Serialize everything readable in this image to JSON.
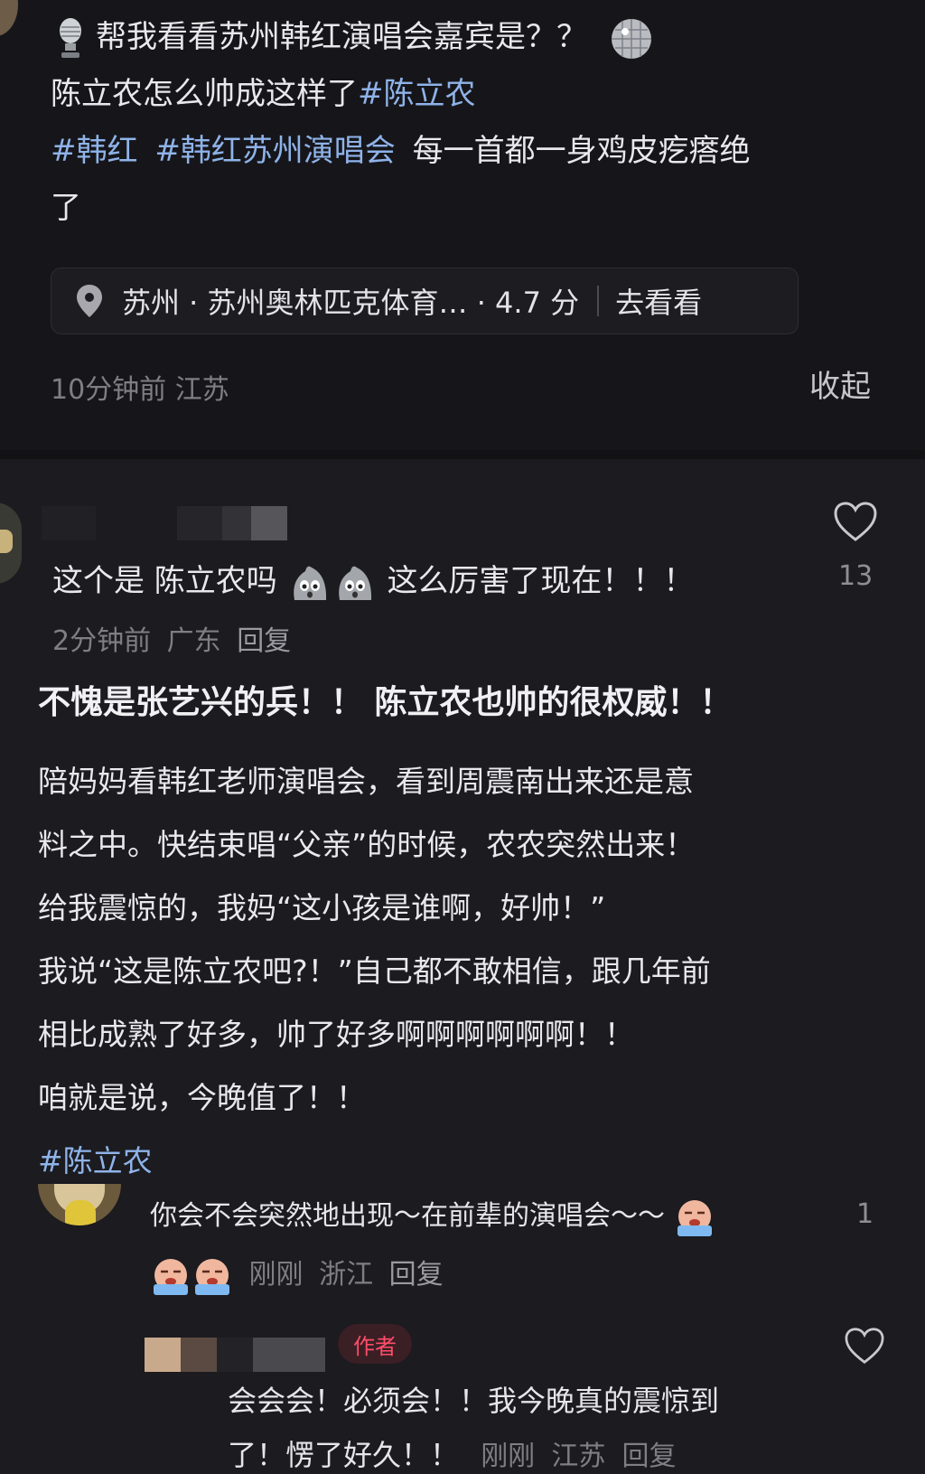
{
  "post": {
    "line1": "帮我看看苏州韩红演唱会嘉宾是？？",
    "line2_text": "陈立农怎么帅成这样了",
    "line2_tag": "#陈立农",
    "line3_tag1": "#韩红",
    "line3_tag2": "#韩红苏州演唱会",
    "line3_text": "每一首都一身鸡皮疙瘩绝",
    "line4": "了",
    "location": "苏州 · 苏州奥林匹克体育… · 4.7 分",
    "location_action": "去看看",
    "time": "10分钟前 江苏",
    "collapse": "收起"
  },
  "comment1": {
    "text": "这个是 陈立农吗",
    "text_tail": "这么厉害了现在！！！",
    "likes": "13",
    "meta_time": "2分钟前",
    "meta_region": "广东",
    "reply": "回复",
    "headline": "不愧是张艺兴的兵！！ 陈立农也帅的很权威！！",
    "body": [
      "陪妈妈看韩红老师演唱会，看到周震南出来还是意",
      "料之中。快结束唱“父亲”的时候，农农突然出来！",
      "给我震惊的，我妈“这小孩是谁啊，好帅！”",
      "我说“这是陈立农吧?！”自己都不敢相信，跟几年前",
      "相比成熟了好多，帅了好多啊啊啊啊啊啊！！",
      "咱就是说，今晚值了！！"
    ],
    "tag": "#陈立农"
  },
  "reply1": {
    "text": "你会不会突然地出现～在前辈的演唱会～～",
    "likes": "1",
    "meta_time": "刚刚",
    "meta_region": "浙江",
    "reply": "回复"
  },
  "reply2": {
    "badge": "作者",
    "line1": "会会会！必须会！！我今晚真的震惊到",
    "line2": "了！愣了好久！！",
    "meta_time": "刚刚",
    "meta_region": "江苏",
    "reply": "回复"
  },
  "colors": {
    "background": "#1b1b20",
    "hashtag": "#8fb3e9",
    "meta": "#7e7e84",
    "author_badge": "#ff4d6a"
  }
}
